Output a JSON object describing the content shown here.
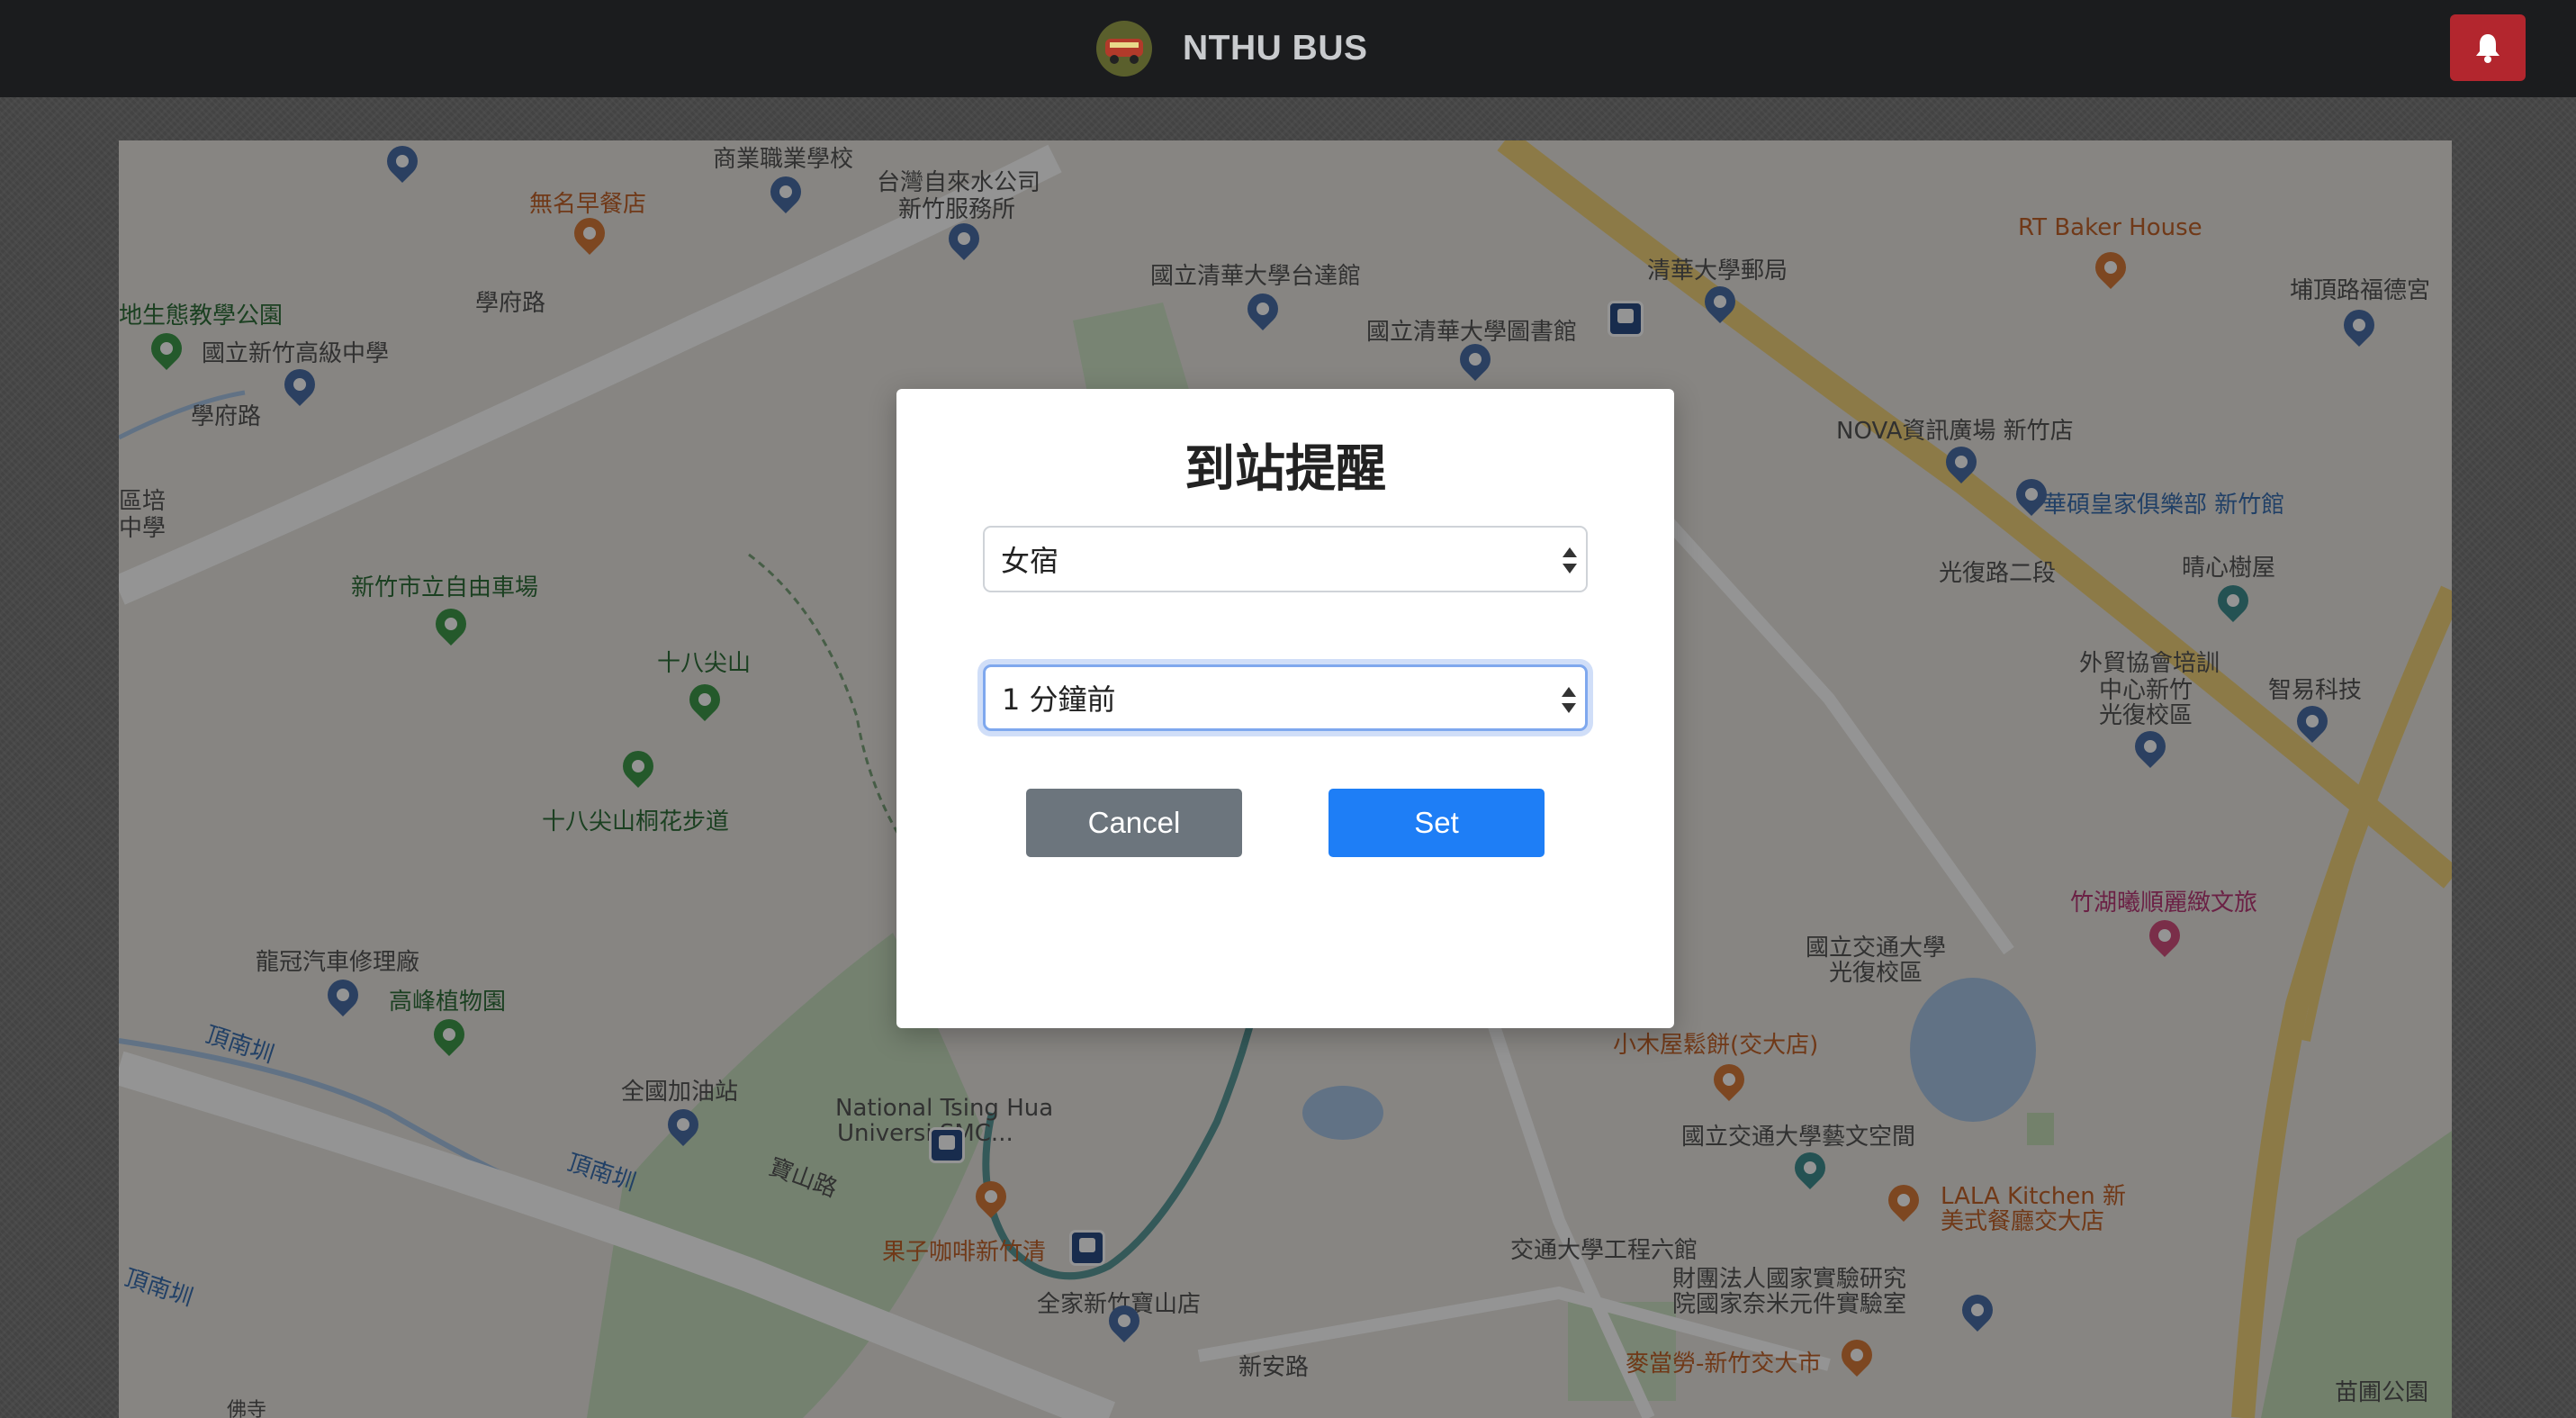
{
  "header": {
    "logo_icon": "bus-logo-icon",
    "title": "NTHU BUS",
    "notification_icon": "bell-icon",
    "notification_button_color": "#b3262e"
  },
  "map": {
    "labels": [
      {
        "text": "商業職業學校",
        "color": "dark"
      },
      {
        "text": "台灣自來水公司",
        "color": "dark"
      },
      {
        "text": "新竹服務所",
        "color": "dark"
      },
      {
        "text": "無名早餐店",
        "color": "orange"
      },
      {
        "text": "地生態教學公園",
        "color": "green"
      },
      {
        "text": "國立新竹高級中學",
        "color": "dark"
      },
      {
        "text": "學府路",
        "color": "dark"
      },
      {
        "text": "學府路",
        "color": "dark"
      },
      {
        "text": "國立清華大學台達館",
        "color": "dark"
      },
      {
        "text": "國立清華大學圖書館",
        "color": "dark"
      },
      {
        "text": "清華大學郵局",
        "color": "dark"
      },
      {
        "text": "RT Baker House",
        "color": "orange"
      },
      {
        "text": "埔頂路福德宮",
        "color": "dark"
      },
      {
        "text": "NOVA資訊廣場 新竹店",
        "color": "dark"
      },
      {
        "text": "華碩皇家俱樂部 新竹館",
        "color": "blue"
      },
      {
        "text": "光復路二段",
        "color": "dark"
      },
      {
        "text": "晴心樹屋",
        "color": "dark"
      },
      {
        "text": "外貿協會培訓",
        "color": "dark"
      },
      {
        "text": "中心新竹",
        "color": "dark"
      },
      {
        "text": "光復校區",
        "color": "dark"
      },
      {
        "text": "智易科技",
        "color": "dark"
      },
      {
        "text": "區培",
        "color": "dark"
      },
      {
        "text": "中學",
        "color": "dark"
      },
      {
        "text": "新竹市立自由車場",
        "color": "green"
      },
      {
        "text": "十八尖山",
        "color": "green"
      },
      {
        "text": "十八尖山桐花步道",
        "color": "green"
      },
      {
        "text": "竹湖曦順麗緻文旅",
        "color": "pink"
      },
      {
        "text": "國立交通大學",
        "color": "dark"
      },
      {
        "text": "光復校區",
        "color": "dark"
      },
      {
        "text": "龍冠汽車修理廠",
        "color": "dark"
      },
      {
        "text": "高峰植物園",
        "color": "green"
      },
      {
        "text": "小木屋鬆餅(交大店)",
        "color": "orange"
      },
      {
        "text": "頂南圳",
        "color": "blue"
      },
      {
        "text": "全國加油站",
        "color": "dark"
      },
      {
        "text": "National Tsing Hua",
        "color": "dark"
      },
      {
        "text": "Universi  SMC...",
        "color": "dark"
      },
      {
        "text": "國立交通大學藝文空間",
        "color": "dark"
      },
      {
        "text": "頂南圳",
        "color": "blue"
      },
      {
        "text": "寶山路",
        "color": "dark"
      },
      {
        "text": "LALA Kitchen 新",
        "color": "orange"
      },
      {
        "text": "美式餐廳交大店",
        "color": "orange"
      },
      {
        "text": "果子咖啡新竹清",
        "color": "orange"
      },
      {
        "text": "交通大學工程六館",
        "color": "dark"
      },
      {
        "text": "頂南圳",
        "color": "blue"
      },
      {
        "text": "財團法人國家實驗研究",
        "color": "dark"
      },
      {
        "text": "院國家奈米元件實驗室",
        "color": "dark"
      },
      {
        "text": "全家新竹寶山店",
        "color": "dark"
      },
      {
        "text": "新安路",
        "color": "dark"
      },
      {
        "text": "麥當勞-新竹交大市",
        "color": "orange"
      },
      {
        "text": "苗圃公園",
        "color": "dark"
      },
      {
        "text": "佛寺",
        "color": "dark"
      }
    ]
  },
  "modal": {
    "title": "到站提醒",
    "stop_select_value": "女宿",
    "time_select_value": "1 分鐘前",
    "cancel_label": "Cancel",
    "set_label": "Set",
    "set_color": "#1e7ef6",
    "cancel_color": "#6c757d"
  }
}
